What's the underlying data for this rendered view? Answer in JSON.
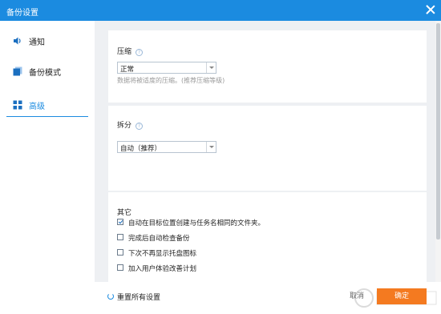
{
  "window": {
    "title": "备份设置"
  },
  "sidebar": {
    "items": [
      {
        "label": "通知",
        "icon": "speaker-icon"
      },
      {
        "label": "备份模式",
        "icon": "copy-icon"
      },
      {
        "label": "高级",
        "icon": "grid-icon",
        "active": true
      }
    ]
  },
  "compression": {
    "title": "压缩",
    "selected": "正常",
    "hint": "数据将被适度的压缩。(推荐压缩等级)"
  },
  "split": {
    "title": "拆分",
    "selected": "自动（推荐）"
  },
  "other": {
    "title": "其它",
    "options": [
      {
        "label": "自动在目标位置创建与任务名相同的文件夹。",
        "checked": true
      },
      {
        "label": "完成后自动检查备份",
        "checked": false
      },
      {
        "label": "下次不再显示托盘图标",
        "checked": false
      },
      {
        "label": "加入用户体验改善计划",
        "checked": false
      }
    ]
  },
  "footer": {
    "reset_label": "重置所有设置",
    "cancel_label": "取消",
    "ok_label": "确定"
  },
  "colors": {
    "titlebar": "#1b8be0",
    "accent": "#1b8be0",
    "ok_button": "#f47a20"
  }
}
